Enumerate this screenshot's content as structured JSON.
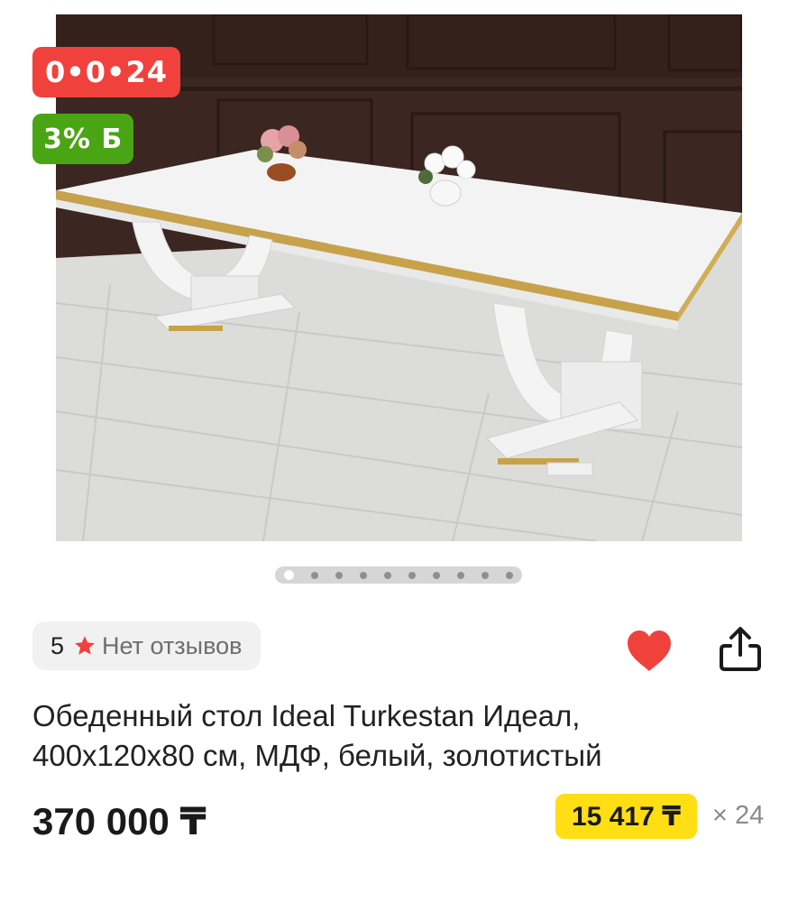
{
  "badges": {
    "timer": "0•0•24",
    "bonus": "3% Б"
  },
  "gallery": {
    "image": "white-dining-table-photo",
    "slide_count": 10,
    "active_slide": 1
  },
  "rating": {
    "value": "5",
    "reviews_text": "Нет отзывов",
    "star_color": "#f0413c"
  },
  "actions": {
    "favorite_icon": "heart-icon",
    "favorite_color": "#f0413c",
    "share_icon": "share-icon"
  },
  "product": {
    "title_line1": "Обеденный стол Ideal Turkestan Идеал,",
    "title_line2": "400x120x80 см, МДФ, белый, золотистый"
  },
  "pricing": {
    "price": "370 000 ₸",
    "installment_amount": "15 417 ₸",
    "installment_months": "× 24",
    "installment_color": "#ffde14"
  }
}
